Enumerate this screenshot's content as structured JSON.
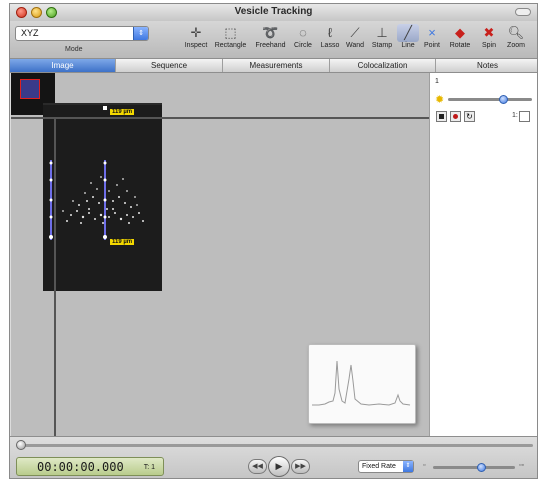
{
  "window": {
    "title": "Vesicle Tracking"
  },
  "toolbar": {
    "mode_value": "XYZ",
    "mode_label": "Mode",
    "tools": [
      {
        "id": "inspect",
        "label": "Inspect",
        "icon": "crosshair-icon"
      },
      {
        "id": "rectangle",
        "label": "Rectangle",
        "icon": "rectangle-select-icon"
      },
      {
        "id": "freehand",
        "label": "Freehand",
        "icon": "freehand-icon"
      },
      {
        "id": "circle",
        "label": "Circle",
        "icon": "circle-select-icon"
      },
      {
        "id": "lasso",
        "label": "Lasso",
        "icon": "lasso-icon"
      },
      {
        "id": "wand",
        "label": "Wand",
        "icon": "wand-icon"
      },
      {
        "id": "stamp",
        "label": "Stamp",
        "icon": "stamp-icon"
      },
      {
        "id": "line",
        "label": "Line",
        "icon": "line-icon"
      },
      {
        "id": "point",
        "label": "Point",
        "icon": "point-icon"
      },
      {
        "id": "rotate",
        "label": "Rotate",
        "icon": "rotate-icon"
      },
      {
        "id": "spin",
        "label": "Spin",
        "icon": "spin-icon"
      },
      {
        "id": "zoom",
        "label": "Zoom",
        "icon": "magnifier-icon"
      }
    ]
  },
  "tabs": [
    {
      "label": "Image",
      "active": true
    },
    {
      "label": "Sequence",
      "active": false
    },
    {
      "label": "Measurements",
      "active": false
    },
    {
      "label": "Colocalization",
      "active": false
    },
    {
      "label": "Notes",
      "active": false
    }
  ],
  "image": {
    "scale_top_label": "119 µm",
    "scale_bottom_label": "119 µm"
  },
  "panel": {
    "channel_number": "1",
    "brightness_level": 0.66,
    "checkbox_label": "1:"
  },
  "playback": {
    "timecode": "00:00:00.000",
    "frame": "T: 1",
    "rate_value": "Fixed Rate",
    "speed_level": 0.58
  },
  "colors": {
    "accent": "#3f78e0",
    "scale_label": "#f4d800",
    "timecode_bg": "#c9d8a4"
  }
}
